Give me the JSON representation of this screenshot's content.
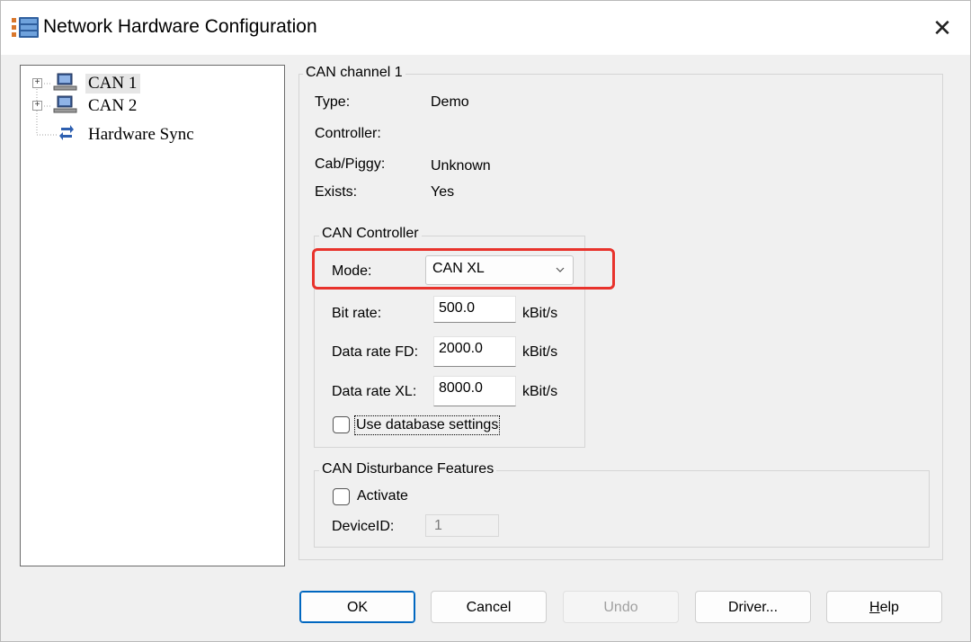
{
  "window": {
    "title": "Network Hardware Configuration",
    "close_glyph": "✕"
  },
  "tree": {
    "items": [
      {
        "label": "CAN 1",
        "icon": "computer-icon",
        "expander": "+"
      },
      {
        "label": "CAN 2",
        "icon": "computer-icon",
        "expander": "+"
      },
      {
        "label": "Hardware Sync",
        "icon": "sync-icon"
      }
    ]
  },
  "channel": {
    "group_title": "CAN channel 1",
    "type_label": "Type:",
    "type_value": "Demo",
    "controller_label": "Controller:",
    "controller_value": "",
    "cab_label": "Cab/Piggy:",
    "cab_value": "Unknown",
    "exists_label": "Exists:",
    "exists_value": "Yes"
  },
  "controller": {
    "group_title": "CAN Controller",
    "mode_label": "Mode:",
    "mode_value": "CAN XL",
    "bitrate_label": "Bit rate:",
    "bitrate_value": "500.0",
    "bitrate_unit": "kBit/s",
    "fd_label": "Data rate FD:",
    "fd_value": "2000.0",
    "fd_unit": "kBit/s",
    "xl_label": "Data rate XL:",
    "xl_value": "8000.0",
    "xl_unit": "kBit/s",
    "use_db_label": "Use database settings",
    "use_db_checked": false
  },
  "disturbance": {
    "group_title": "CAN Disturbance Features",
    "activate_label": "Activate",
    "activate_checked": false,
    "device_label": "DeviceID:",
    "device_value": "1"
  },
  "buttons": {
    "ok": "OK",
    "cancel": "Cancel",
    "undo": "Undo",
    "driver": "Driver...",
    "help_rest": "elp",
    "help_mnemonic": "H"
  },
  "colors": {
    "highlight": "#e8332c",
    "default_button": "#0067c0",
    "tree_selection": "#e6e6e6"
  }
}
